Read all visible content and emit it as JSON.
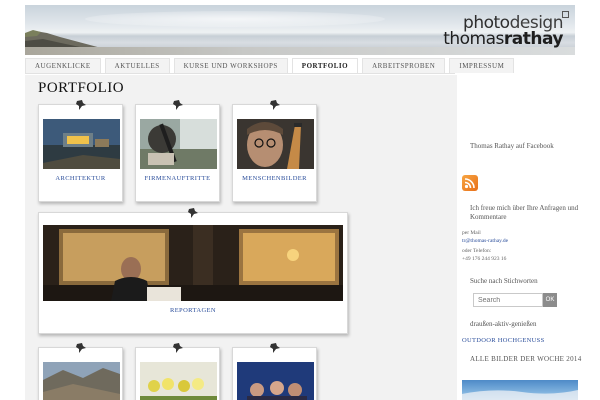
{
  "brand": {
    "line1_a": "photo",
    "line1_b": "design",
    "line2_a": "thomas",
    "line2_b": "rathay"
  },
  "nav": {
    "tabs": [
      {
        "label": "AUGENKLICKE",
        "active": false
      },
      {
        "label": "AKTUELLES",
        "active": false
      },
      {
        "label": "KURSE UND WORKSHOPS",
        "active": false
      },
      {
        "label": "PORTFOLIO",
        "active": true
      },
      {
        "label": "ARBEITSPROBEN",
        "active": false
      },
      {
        "label": "IMPRESSUM",
        "active": false
      }
    ]
  },
  "page": {
    "title": "PORTFOLIO"
  },
  "portfolio": {
    "row1": [
      {
        "label": "ARCHITEKTUR"
      },
      {
        "label": "FIRMENAUFTRITTE"
      },
      {
        "label": "MENSCHENBILDER"
      }
    ],
    "featured": {
      "label": "REPORTAGEN"
    }
  },
  "sidebar": {
    "facebook": "Thomas Rathay auf Facebook",
    "contact_intro": "Ich freue mich über Ihre Anfragen und Kommentare",
    "mail_label": "per Mail",
    "mail": "tr@thomas-rathay.de",
    "phone_label": "oder Telefon:",
    "phone": "+49 176 244 923 16",
    "search_heading": "Suche nach Stichworten",
    "search_placeholder": "Search",
    "search_button": "OK",
    "tagline": "draußen-aktiv-genießen",
    "outdoor_link": "OUTDOOR HOCHGENUSS",
    "week_heading": "ALLE BILDER DER WOCHE 2014"
  },
  "colors": {
    "link": "#2b4e9b",
    "main_bg": "#f2f2f2",
    "rss": "#f08a2c"
  }
}
